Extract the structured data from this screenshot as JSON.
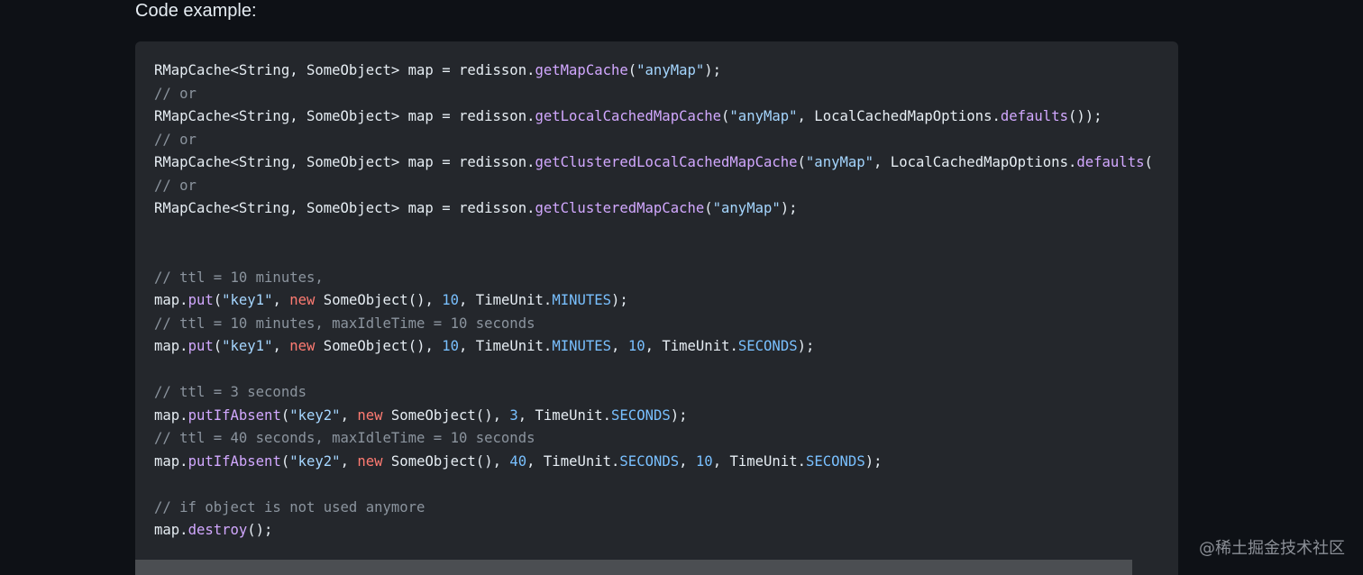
{
  "section_label": "Code example:",
  "watermark": "@稀土掘金技术社区",
  "code_lines": [
    [
      {
        "t": "plain",
        "v": "RMapCache<String, SomeObject> map = redisson."
      },
      {
        "t": "method",
        "v": "getMapCache"
      },
      {
        "t": "plain",
        "v": "("
      },
      {
        "t": "string",
        "v": "\"anyMap\""
      },
      {
        "t": "plain",
        "v": ");"
      }
    ],
    [
      {
        "t": "comment",
        "v": "// or"
      }
    ],
    [
      {
        "t": "plain",
        "v": "RMapCache<String, SomeObject> map = redisson."
      },
      {
        "t": "method",
        "v": "getLocalCachedMapCache"
      },
      {
        "t": "plain",
        "v": "("
      },
      {
        "t": "string",
        "v": "\"anyMap\""
      },
      {
        "t": "plain",
        "v": ", LocalCachedMapOptions."
      },
      {
        "t": "method",
        "v": "defaults"
      },
      {
        "t": "plain",
        "v": "());"
      }
    ],
    [
      {
        "t": "comment",
        "v": "// or"
      }
    ],
    [
      {
        "t": "plain",
        "v": "RMapCache<String, SomeObject> map = redisson."
      },
      {
        "t": "method",
        "v": "getClusteredLocalCachedMapCache"
      },
      {
        "t": "plain",
        "v": "("
      },
      {
        "t": "string",
        "v": "\"anyMap\""
      },
      {
        "t": "plain",
        "v": ", LocalCachedMapOptions."
      },
      {
        "t": "method",
        "v": "defaults"
      },
      {
        "t": "plain",
        "v": "("
      }
    ],
    [
      {
        "t": "comment",
        "v": "// or"
      }
    ],
    [
      {
        "t": "plain",
        "v": "RMapCache<String, SomeObject> map = redisson."
      },
      {
        "t": "method",
        "v": "getClusteredMapCache"
      },
      {
        "t": "plain",
        "v": "("
      },
      {
        "t": "string",
        "v": "\"anyMap\""
      },
      {
        "t": "plain",
        "v": ");"
      }
    ],
    [],
    [],
    [
      {
        "t": "comment",
        "v": "// ttl = 10 minutes,"
      }
    ],
    [
      {
        "t": "plain",
        "v": "map."
      },
      {
        "t": "method",
        "v": "put"
      },
      {
        "t": "plain",
        "v": "("
      },
      {
        "t": "string",
        "v": "\"key1\""
      },
      {
        "t": "plain",
        "v": ", "
      },
      {
        "t": "keyword",
        "v": "new"
      },
      {
        "t": "plain",
        "v": " SomeObject(), "
      },
      {
        "t": "number",
        "v": "10"
      },
      {
        "t": "plain",
        "v": ", TimeUnit."
      },
      {
        "t": "const",
        "v": "MINUTES"
      },
      {
        "t": "plain",
        "v": ");"
      }
    ],
    [
      {
        "t": "comment",
        "v": "// ttl = 10 minutes, maxIdleTime = 10 seconds"
      }
    ],
    [
      {
        "t": "plain",
        "v": "map."
      },
      {
        "t": "method",
        "v": "put"
      },
      {
        "t": "plain",
        "v": "("
      },
      {
        "t": "string",
        "v": "\"key1\""
      },
      {
        "t": "plain",
        "v": ", "
      },
      {
        "t": "keyword",
        "v": "new"
      },
      {
        "t": "plain",
        "v": " SomeObject(), "
      },
      {
        "t": "number",
        "v": "10"
      },
      {
        "t": "plain",
        "v": ", TimeUnit."
      },
      {
        "t": "const",
        "v": "MINUTES"
      },
      {
        "t": "plain",
        "v": ", "
      },
      {
        "t": "number",
        "v": "10"
      },
      {
        "t": "plain",
        "v": ", TimeUnit."
      },
      {
        "t": "const",
        "v": "SECONDS"
      },
      {
        "t": "plain",
        "v": ");"
      }
    ],
    [],
    [
      {
        "t": "comment",
        "v": "// ttl = 3 seconds"
      }
    ],
    [
      {
        "t": "plain",
        "v": "map."
      },
      {
        "t": "method",
        "v": "putIfAbsent"
      },
      {
        "t": "plain",
        "v": "("
      },
      {
        "t": "string",
        "v": "\"key2\""
      },
      {
        "t": "plain",
        "v": ", "
      },
      {
        "t": "keyword",
        "v": "new"
      },
      {
        "t": "plain",
        "v": " SomeObject(), "
      },
      {
        "t": "number",
        "v": "3"
      },
      {
        "t": "plain",
        "v": ", TimeUnit."
      },
      {
        "t": "const",
        "v": "SECONDS"
      },
      {
        "t": "plain",
        "v": ");"
      }
    ],
    [
      {
        "t": "comment",
        "v": "// ttl = 40 seconds, maxIdleTime = 10 seconds"
      }
    ],
    [
      {
        "t": "plain",
        "v": "map."
      },
      {
        "t": "method",
        "v": "putIfAbsent"
      },
      {
        "t": "plain",
        "v": "("
      },
      {
        "t": "string",
        "v": "\"key2\""
      },
      {
        "t": "plain",
        "v": ", "
      },
      {
        "t": "keyword",
        "v": "new"
      },
      {
        "t": "plain",
        "v": " SomeObject(), "
      },
      {
        "t": "number",
        "v": "40"
      },
      {
        "t": "plain",
        "v": ", TimeUnit."
      },
      {
        "t": "const",
        "v": "SECONDS"
      },
      {
        "t": "plain",
        "v": ", "
      },
      {
        "t": "number",
        "v": "10"
      },
      {
        "t": "plain",
        "v": ", TimeUnit."
      },
      {
        "t": "const",
        "v": "SECONDS"
      },
      {
        "t": "plain",
        "v": ");"
      }
    ],
    [],
    [
      {
        "t": "comment",
        "v": "// if object is not used anymore"
      }
    ],
    [
      {
        "t": "plain",
        "v": "map."
      },
      {
        "t": "method",
        "v": "destroy"
      },
      {
        "t": "plain",
        "v": "();"
      }
    ]
  ]
}
